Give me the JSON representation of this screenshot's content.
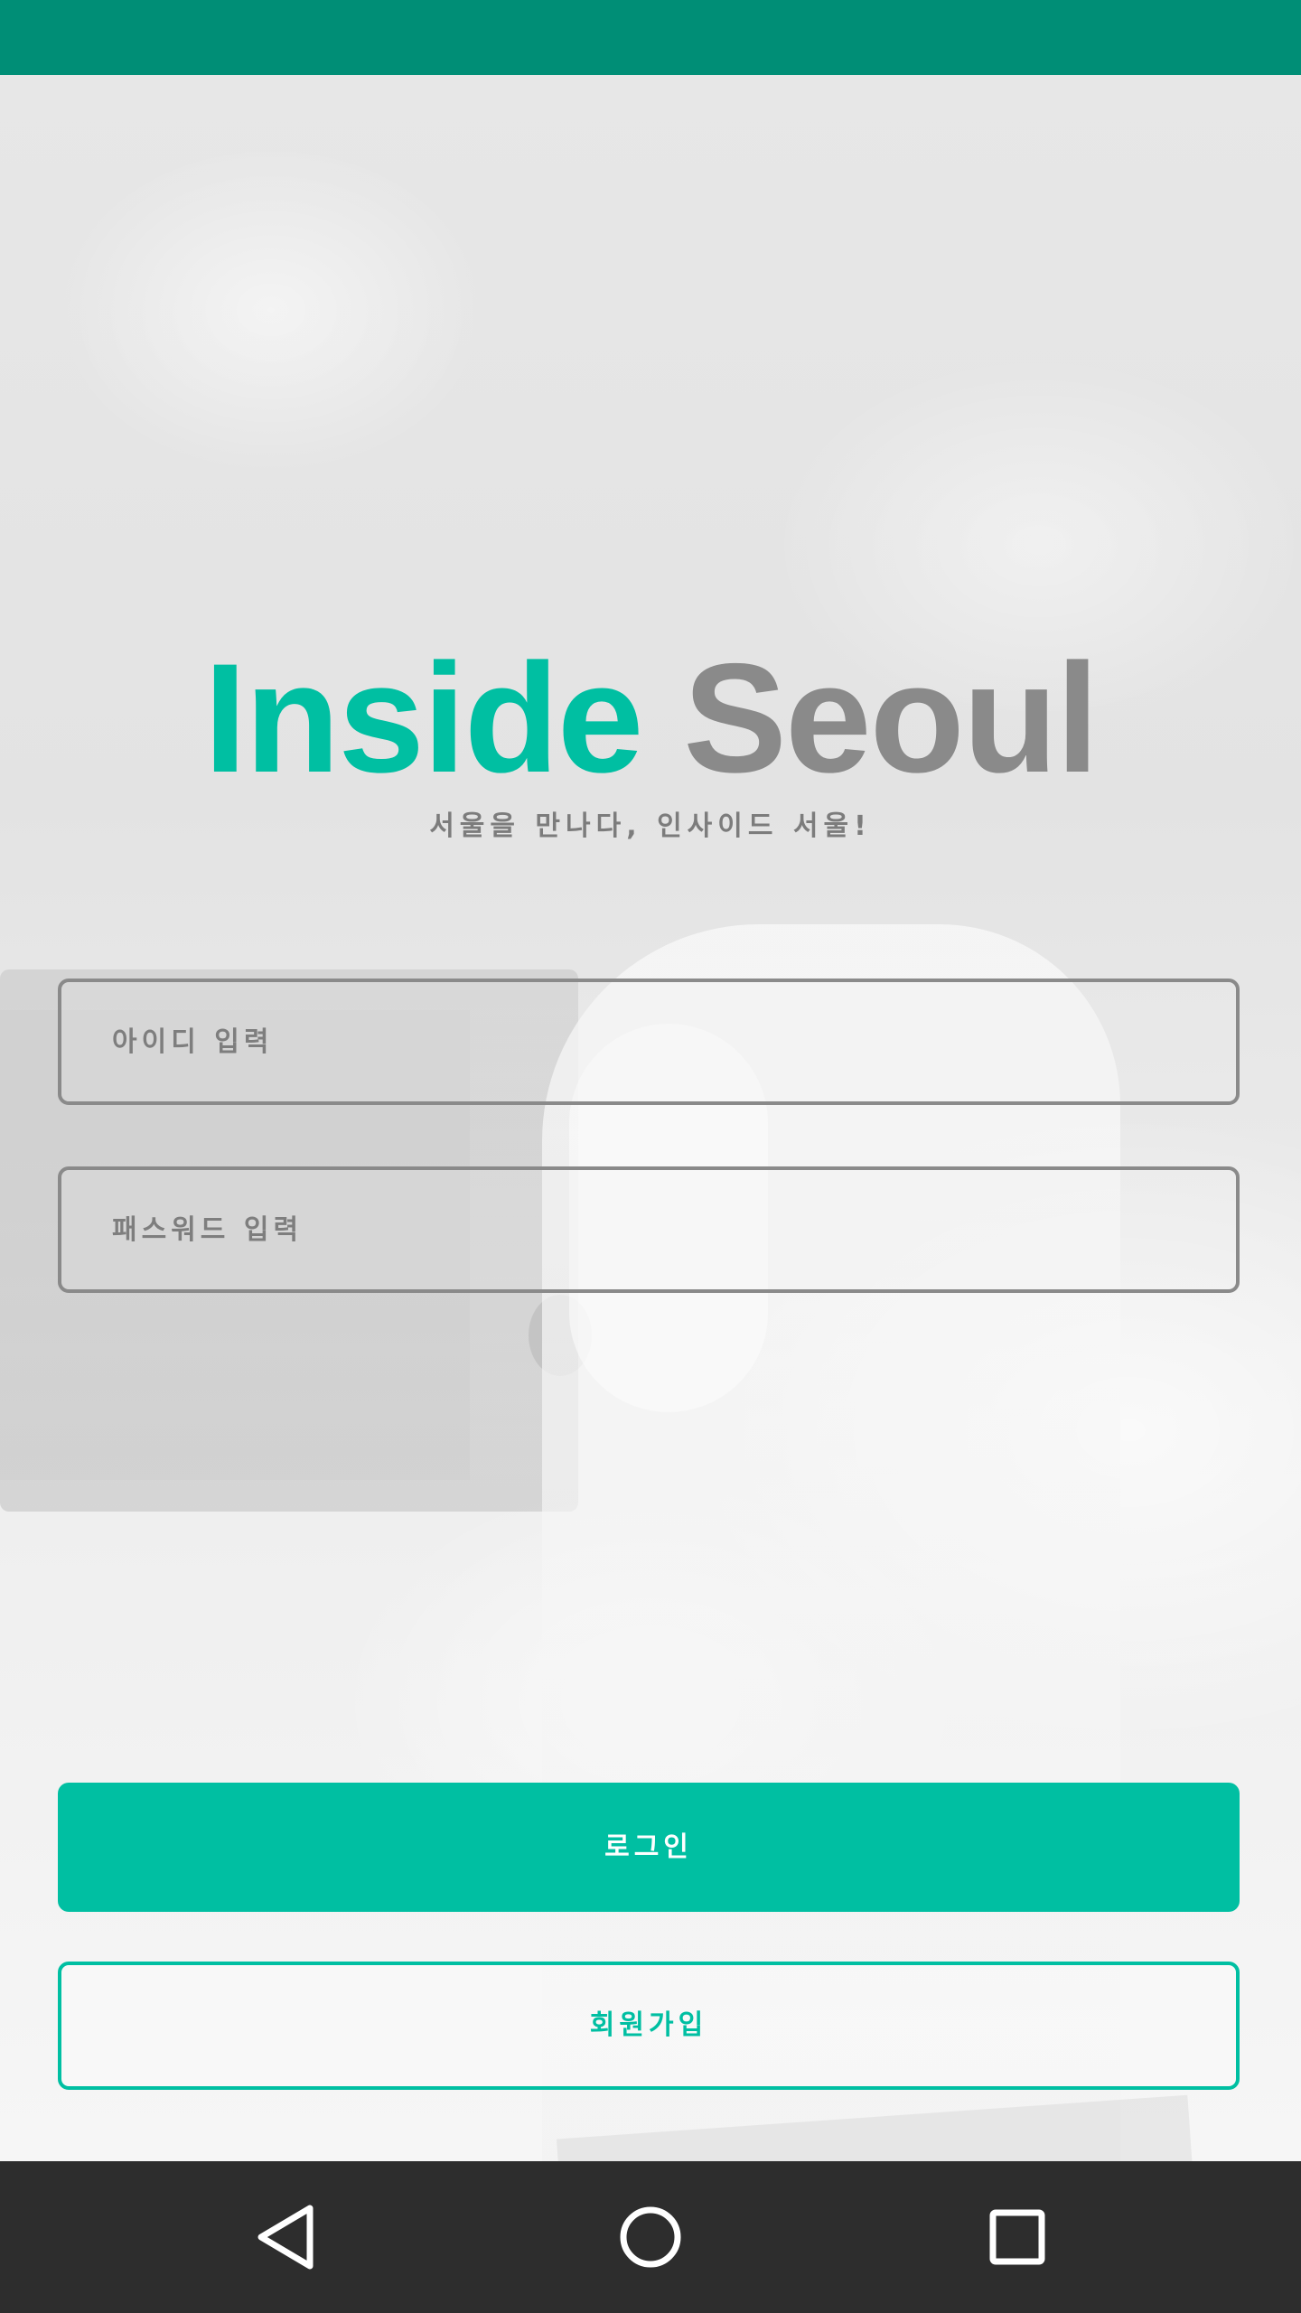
{
  "app": {
    "title_word1": "Inside",
    "title_word2": "Seoul",
    "tagline": "서울을 만나다, 인사이드 서울!"
  },
  "form": {
    "id_placeholder": "아이디 입력",
    "password_placeholder": "패스워드 입력",
    "login_label": "로그인",
    "signup_label": "회원가입"
  },
  "colors": {
    "accent": "#00bfa2",
    "status_bar": "#008e76",
    "title_secondary": "#8a8a8a",
    "nav_bar": "#2d2d2d"
  },
  "nav": {
    "back_icon": "back-triangle-icon",
    "home_icon": "home-circle-icon",
    "recent_icon": "recent-apps-square-icon"
  }
}
